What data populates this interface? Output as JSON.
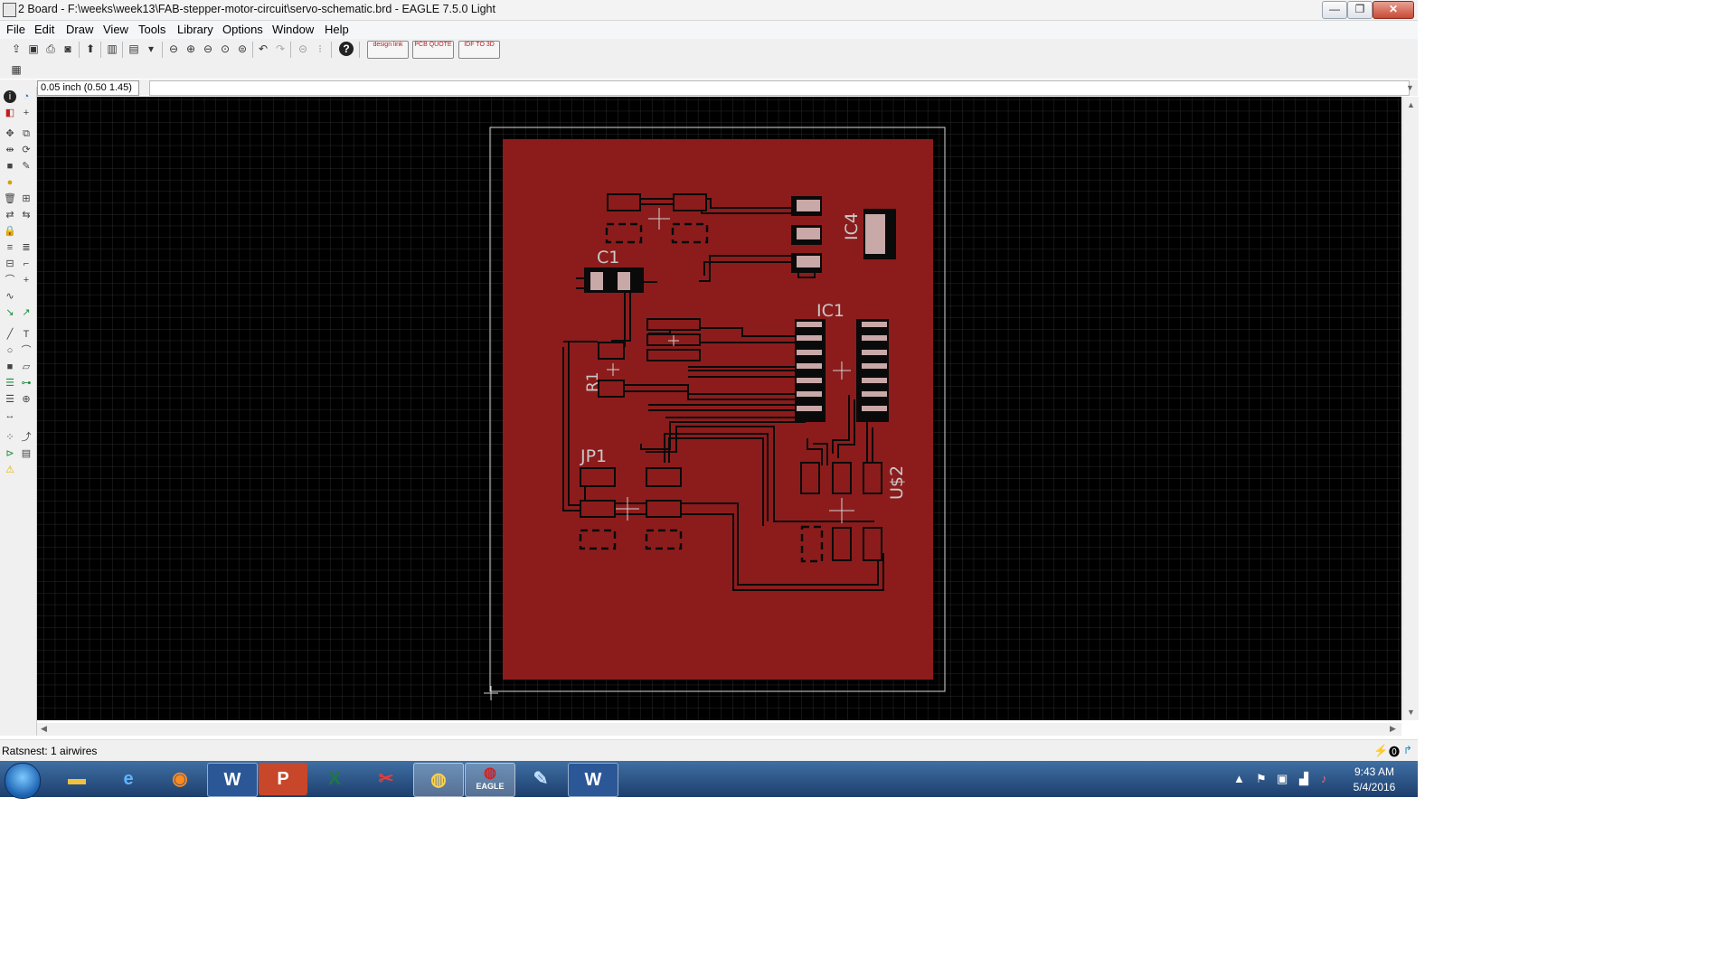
{
  "window": {
    "title": "2 Board - F:\\weeks\\week13\\FAB-stepper-motor-circuit\\servo-schematic.brd - EAGLE 7.5.0 Light",
    "minimize": "—",
    "maximize": "❐",
    "close": "✕"
  },
  "menu": [
    "File",
    "Edit",
    "Draw",
    "View",
    "Tools",
    "Library",
    "Options",
    "Window",
    "Help"
  ],
  "toolbar": {
    "ext_buttons": [
      "design link",
      "PCB QUOTE",
      "IDF TO 3D"
    ]
  },
  "command": {
    "coordinate": "0.05 inch (0.50 1.45)",
    "input_value": ""
  },
  "board": {
    "copper_color": "#8c1c1c",
    "labels": {
      "c1": "C1",
      "ic4": "IC4",
      "ic1": "IC1",
      "r1": "R1",
      "jp1": "JP1",
      "u2": "U$2"
    }
  },
  "status": {
    "text": "Ratsnest: 1 airwires"
  },
  "taskbar": {
    "apps": [
      "file-explorer",
      "internet-explorer",
      "firefox",
      "word",
      "powerpoint",
      "excel",
      "snipping-tool",
      "browser",
      "eagle",
      "paint",
      "word"
    ],
    "eagle_label": "EAGLE",
    "time": "9:43 AM",
    "date": "5/4/2016"
  }
}
